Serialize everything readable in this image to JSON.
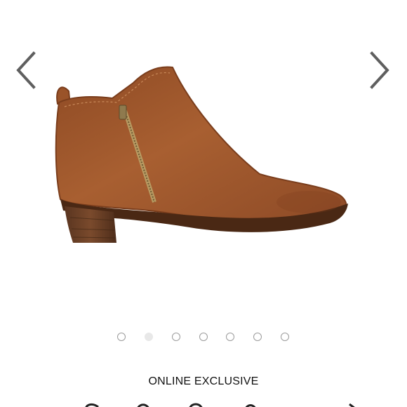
{
  "carousel": {
    "prev_icon": "chevron-left-icon",
    "next_icon": "chevron-right-icon",
    "slide_count": 7,
    "active_index": 1,
    "image_subject": "ankle boot"
  },
  "product": {
    "badge": "ONLINE EXCLUSIVE"
  },
  "colors": {
    "arrow": "#5f5f5f",
    "leather": "#a35a2e",
    "heel": "#6a3f25"
  }
}
